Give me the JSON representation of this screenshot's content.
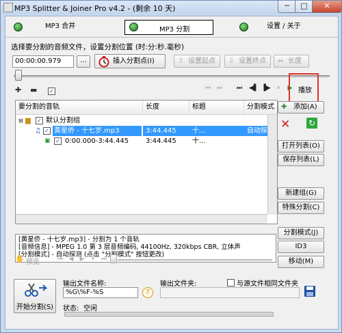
{
  "window": {
    "title": "MP3 Splitter & Joiner Pro v4.2 - (剩余 10 天)",
    "min": "─",
    "max": "□",
    "close": "✕"
  },
  "modes": {
    "join": "MP3 合并",
    "split": "MP3 分割",
    "settings": "设置 / 关于"
  },
  "split": {
    "instructions": "选择要分割的音频文件，设置分割位置 (时:分:秒.毫秒)",
    "time_value": "00:00:00.979",
    "ellipsis": "...",
    "insert_label": "插入分割点(I)",
    "set_start_label": "设置起点",
    "set_end_label": "设置终点",
    "length_label": "长度",
    "play_label": "播放",
    "check_mark": "✓"
  },
  "list": {
    "columns": [
      "要分割的音轨",
      "长度",
      "标题",
      "分割模式"
    ],
    "group": {
      "label": "默认分割组"
    },
    "rows": [
      {
        "track": "黄星侨 - 十七岁.mp3",
        "length": "3:44.445",
        "title": "十...",
        "mode": "自动探测"
      },
      {
        "track": "0:00.000-3:44.445",
        "length": "3:44.445",
        "title": "十...",
        "mode": ""
      }
    ]
  },
  "right_buttons": {
    "add": "添加(A)",
    "open_list": "打开列表(O)",
    "save_list": "保存列表(L)",
    "new_group": "新建组(G)",
    "special_split": "特殊分割(C)",
    "split_mode": "分割模式(J)",
    "id3": "ID3",
    "move": "移动(M)"
  },
  "info_text": [
    "[黄星侨 - 十七岁.mp3] - 分割为 1 个音轨",
    "[音频信息] - MPEG 1.0 第 3 层音频编码, 44100Hz, 320kbps CBR, 立体声",
    "[分割模式] - 自动探测 (点击 \"分割模式\" 按钮更改)"
  ],
  "preview": {
    "label": "预览"
  },
  "output": {
    "start_label": "开始分割(S)",
    "filename_label": "输出文件名称:",
    "filename_value": "%G\\%F-%S",
    "help": "?",
    "folder_label": "输出文件夹:",
    "same_folder_label": "与源文件相同文件夹",
    "status_label": "状态:",
    "status_value": "空闲"
  }
}
